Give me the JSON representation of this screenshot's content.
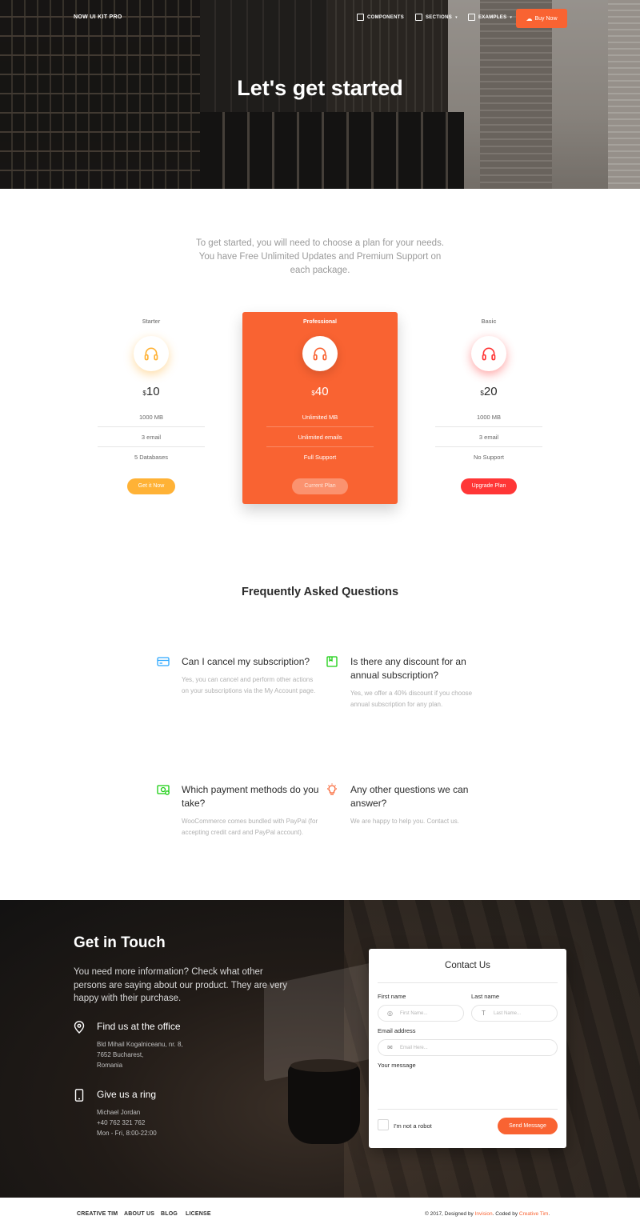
{
  "nav": {
    "brand": "NOW UI KIT PRO",
    "components": "COMPONENTS",
    "sections": "SECTIONS",
    "examples": "EXAMPLES",
    "buy": "Buy Now"
  },
  "hero": {
    "title": "Let's get started"
  },
  "pricing": {
    "intro": "To get started, you will need to choose a plan for your needs. You have Free Unlimited Updates and Premium Support on each package.",
    "plans": [
      {
        "name": "Starter",
        "currency": "$",
        "price": "10",
        "features": [
          "1000 MB",
          "3 email",
          "5 Databases"
        ],
        "button": "Get it Now",
        "accent": "#ffb236"
      },
      {
        "name": "Professional",
        "currency": "$",
        "price": "40",
        "features": [
          "Unlimited MB",
          "Unlimited emails",
          "Full Support"
        ],
        "button": "Current Plan",
        "accent": "#f96332"
      },
      {
        "name": "Basic",
        "currency": "$",
        "price": "20",
        "features": [
          "1000 MB",
          "3 email",
          "No Support"
        ],
        "button": "Upgrade Plan",
        "accent": "#ff3636"
      }
    ]
  },
  "faq": {
    "title": "Frequently Asked Questions",
    "items": [
      {
        "question": "Can I cancel my subscription?",
        "answer": "Yes, you can cancel and perform other actions on your subscriptions via the My Account page.",
        "icon": "credit-card-icon",
        "color": "#2ca8ff"
      },
      {
        "question": "Is there any discount for an annual subscription?",
        "answer": "Yes, we offer a 40% discount if you choose annual subscription for any plan.",
        "icon": "gift-box-icon",
        "color": "#18ce0f"
      },
      {
        "question": "Which payment methods do you take?",
        "answer": "WooCommerce comes bundled with PayPal (for accepting credit card and PayPal account).",
        "icon": "money-icon",
        "color": "#18ce0f"
      },
      {
        "question": "Any other questions we can answer?",
        "answer": "We are happy to help you. Contact us.",
        "icon": "bulb-icon",
        "color": "#f96332"
      }
    ]
  },
  "contact": {
    "title": "Get in Touch",
    "description": "You need more information? Check what other persons are saying about our product. They are very happy with their purchase.",
    "office": {
      "title": "Find us at the office",
      "lines": [
        "Bld Mihail Kogalniceanu, nr. 8,",
        "7652 Bucharest,",
        "Romania"
      ]
    },
    "phone": {
      "title": "Give us a ring",
      "lines": [
        "Michael Jordan",
        "+40 762 321 762",
        "Mon - Fri, 8:00-22:00"
      ]
    },
    "form": {
      "title": "Contact Us",
      "first_name_label": "First name",
      "first_name_placeholder": "First Name...",
      "last_name_label": "Last name",
      "last_name_placeholder": "Last Name...",
      "email_label": "Email address",
      "email_placeholder": "Email Here...",
      "message_label": "Your message",
      "captcha_label": "I'm not a robot",
      "send": "Send Message"
    }
  },
  "footer": {
    "links": [
      "CREATIVE TIM",
      "ABOUT US",
      "BLOG",
      "LICENSE"
    ],
    "copy_prefix": "© 2017, Designed by ",
    "designer": "Invision",
    "copy_mid": ". Coded by ",
    "coder": "Creative Tim",
    "copy_suffix": "."
  },
  "colors": {
    "primary": "#f96332",
    "warning": "#ffb236",
    "danger": "#ff3636",
    "info": "#2ca8ff",
    "success": "#18ce0f"
  }
}
